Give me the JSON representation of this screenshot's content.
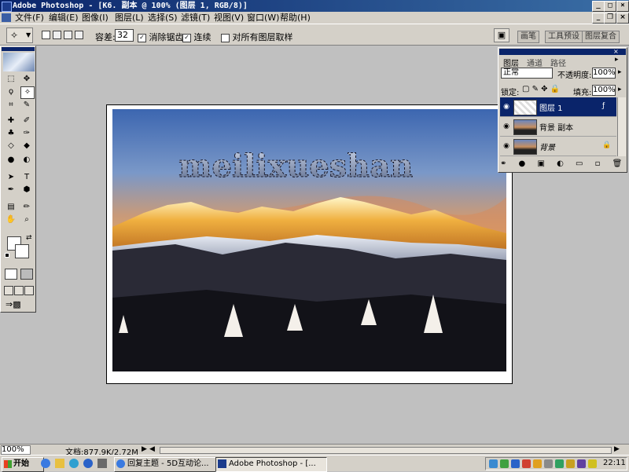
{
  "window": {
    "title": "Adobe Photoshop - [K6. 副本 @ 100% (图层 1, RGB/8)]",
    "min_label": "_",
    "max_label": "□",
    "close_label": "×",
    "doc_restore_label": "❐"
  },
  "menu": {
    "items": [
      "文件(F)",
      "编辑(E)",
      "图像(I)",
      "图层(L)",
      "选择(S)",
      "滤镜(T)",
      "视图(V)",
      "窗口(W)",
      "帮助(H)"
    ]
  },
  "options": {
    "tolerance_label": "容差:",
    "tolerance_value": "32",
    "antialias_label": "消除锯齿",
    "antialias_checked": "✓",
    "contiguous_label": "连续",
    "contiguous_checked": "✓",
    "all_layers_label": "对所有图层取样",
    "palette_tabs": [
      "画笔",
      "工具预设",
      "图层复合"
    ]
  },
  "document": {
    "watermark_text": "meilixueshan"
  },
  "layers_panel": {
    "tabs": [
      "图层",
      "通道",
      "路径"
    ],
    "blend_mode": "正常",
    "opacity_label": "不透明度:",
    "opacity_value": "100%",
    "lock_label": "锁定:",
    "fill_label": "填充:",
    "fill_value": "100%",
    "layers": [
      {
        "name": "图层 1",
        "selected": true
      },
      {
        "name": "背景 副本",
        "selected": false
      },
      {
        "name": "背景",
        "selected": false
      }
    ]
  },
  "status": {
    "zoom": "100%",
    "doc_info": "文档:877.9K/2.72M"
  },
  "taskbar": {
    "start_label": "开始",
    "tasks": [
      "回复主题 - 5D互动论...",
      "Adobe Photoshop - [..."
    ],
    "clock": "22:11"
  },
  "colors": {
    "titlebar": "#0a246a",
    "selection": "#0a246a",
    "chrome": "#d4d0c8",
    "workspace": "#c0c0c0"
  }
}
